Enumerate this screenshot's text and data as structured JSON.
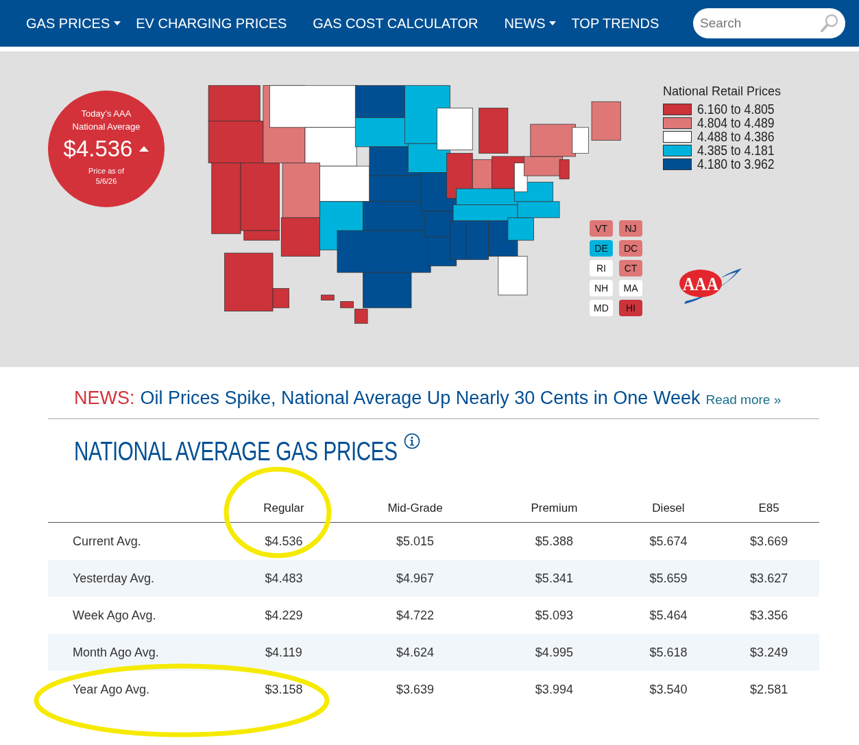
{
  "nav": {
    "items": [
      {
        "label": "GAS PRICES",
        "has_dropdown": true
      },
      {
        "label": "EV CHARGING PRICES",
        "has_dropdown": false
      },
      {
        "label": "GAS COST CALCULATOR",
        "has_dropdown": false
      },
      {
        "label": "NEWS",
        "has_dropdown": true
      },
      {
        "label": "TOP TRENDS",
        "has_dropdown": false
      }
    ],
    "search": {
      "placeholder": "Search"
    }
  },
  "national_average": {
    "title_lines": [
      "Today’s AAA",
      "National Average"
    ],
    "price": "$4.536",
    "date_lines": [
      "Price as of",
      "5/6/26"
    ]
  },
  "legend": {
    "title": "National Retail Prices",
    "items": [
      {
        "label": "6.160 to 4.805",
        "color": "#cc333a"
      },
      {
        "label": "4.804 to 4.489",
        "color": "#df7777"
      },
      {
        "label": "4.488 to 4.386",
        "color": "#ffffff"
      },
      {
        "label": "4.385 to 4.181",
        "color": "#00b3dc"
      },
      {
        "label": "4.180 to 3.962",
        "color": "#004f93"
      }
    ]
  },
  "state_badges": [
    {
      "label": "VT",
      "color": "#df7777"
    },
    {
      "label": "NJ",
      "color": "#df7777"
    },
    {
      "label": "DE",
      "color": "#00b3dc"
    },
    {
      "label": "DC",
      "color": "#df7777"
    },
    {
      "label": "RI",
      "color": "#ffffff"
    },
    {
      "label": "CT",
      "color": "#df7777"
    },
    {
      "label": "NH",
      "color": "#ffffff"
    },
    {
      "label": "MA",
      "color": "#ffffff"
    },
    {
      "label": "MD",
      "color": "#ffffff"
    },
    {
      "label": "HI",
      "color": "#cc333a"
    }
  ],
  "logo": {
    "text": "AAA"
  },
  "news": {
    "label": "NEWS:",
    "headline": "Oil Prices Spike, National Average Up Nearly 30 Cents in One Week",
    "link": "Read more »"
  },
  "section_title": "NATIONAL AVERAGE GAS PRICES",
  "table": {
    "columns": [
      "Regular",
      "Mid-Grade",
      "Premium",
      "Diesel",
      "E85"
    ],
    "rows": [
      {
        "label": "Current Avg.",
        "values": [
          "$4.536",
          "$5.015",
          "$5.388",
          "$5.674",
          "$3.669"
        ]
      },
      {
        "label": "Yesterday Avg.",
        "values": [
          "$4.483",
          "$4.967",
          "$5.341",
          "$5.659",
          "$3.627"
        ]
      },
      {
        "label": "Week Ago Avg.",
        "values": [
          "$4.229",
          "$4.722",
          "$5.093",
          "$5.464",
          "$3.356"
        ]
      },
      {
        "label": "Month Ago Avg.",
        "values": [
          "$4.119",
          "$4.624",
          "$4.995",
          "$5.618",
          "$3.249"
        ]
      },
      {
        "label": "Year Ago Avg.",
        "values": [
          "$3.158",
          "$3.639",
          "$3.994",
          "$3.540",
          "$2.581"
        ]
      }
    ]
  }
}
